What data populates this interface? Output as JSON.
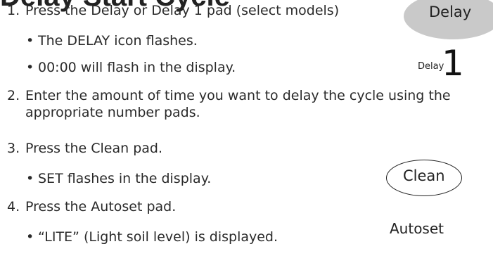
{
  "heading": "Delay Start Cycle",
  "steps": [
    {
      "number": "1.",
      "text": "Press the Delay or Delay 1 pad (select models)",
      "bullets": [
        "The DELAY icon flashes.",
        "00:00 will flash in the display."
      ]
    },
    {
      "number": "2.",
      "text": "Enter the amount of time you want to delay the cycle using the appropriate number pads.",
      "bullets": []
    },
    {
      "number": "3.",
      "text": "Press the Clean pad.",
      "bullets": [
        "SET flashes in the display."
      ]
    },
    {
      "number": "4.",
      "text": "Press the Autoset pad.",
      "bullets": [
        "“LITE” (Light soil level) is displayed."
      ]
    }
  ],
  "bullet_glyph": "•",
  "pads": {
    "delay": "Delay",
    "delay1_word": "Delay",
    "delay1_number": "1",
    "clean": "Clean",
    "autoset": "Autoset"
  }
}
